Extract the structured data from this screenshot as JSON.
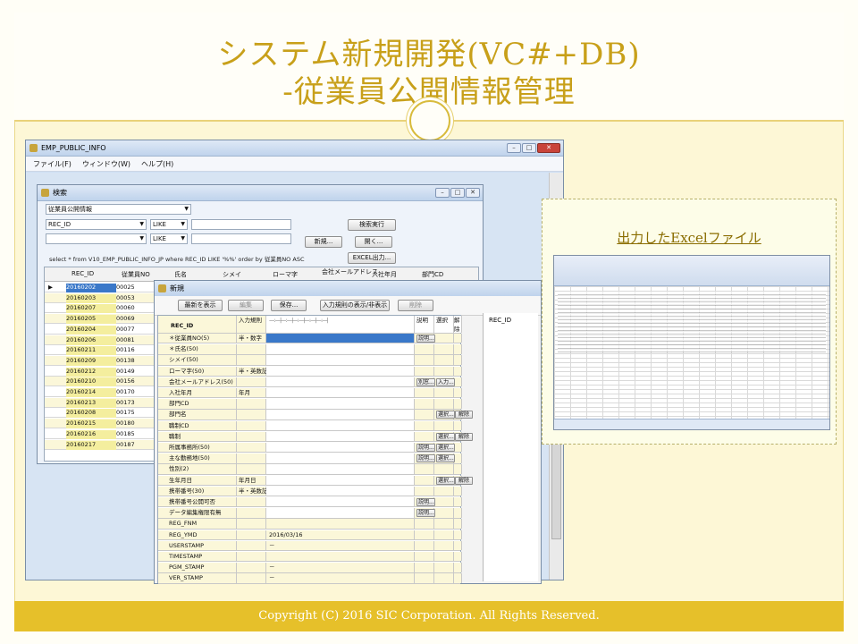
{
  "slide": {
    "title_line1": "システム新規開発(VC#+DB)",
    "title_line2": "-従業員公開情報管理",
    "footer": "Copyright (C) 2016 SIC Corporation. All Rights Reserved.",
    "callout_label": "出力したExcelファイル"
  },
  "main_window": {
    "title": "EMP_PUBLIC_INFO",
    "menu": [
      "ファイル(F)",
      "ウィンドウ(W)",
      "ヘルプ(H)"
    ]
  },
  "search_window": {
    "title": "検索",
    "table_select": "従業員公開情報",
    "cond1_field": "REC_ID",
    "cond1_op": "LIKE",
    "cond2_op": "LIKE",
    "btn_search": "検索実行",
    "btn_new": "新規...",
    "btn_open": "開く...",
    "btn_excel": "EXCEL出力...",
    "sql": "select * from V10_EMP_PUBLIC_INFO_JP  where  REC_ID LIKE '%%'  order by 従業員NO ASC",
    "grid_headers": [
      "REC_ID",
      "従業員NO",
      "氏名",
      "シメイ",
      "ローマ字",
      "会社メールアドレス",
      "入社年月",
      "部門CD"
    ],
    "rows": [
      [
        "20160202",
        "00025"
      ],
      [
        "20160203",
        "00053"
      ],
      [
        "20160207",
        "00060"
      ],
      [
        "20160205",
        "00069"
      ],
      [
        "20160204",
        "00077"
      ],
      [
        "20160206",
        "00081"
      ],
      [
        "20160211",
        "00116"
      ],
      [
        "20160209",
        "00138"
      ],
      [
        "20160212",
        "00149"
      ],
      [
        "20160210",
        "00156"
      ],
      [
        "20160214",
        "00170"
      ],
      [
        "20160213",
        "00173"
      ],
      [
        "20160208",
        "00175"
      ],
      [
        "20160215",
        "00180"
      ],
      [
        "20160216",
        "00185"
      ],
      [
        "20160217",
        "00187"
      ]
    ]
  },
  "new_window": {
    "title": "新規",
    "toolbar": [
      "最新を表示",
      "編集",
      "保存...",
      "入力規則の表示/非表示",
      "削除"
    ],
    "col_headers": {
      "rule": "入力規則",
      "explain": "説明",
      "select": "選択",
      "clear": "解除",
      "first_field": "REC_ID"
    },
    "fields": [
      {
        "label": "＊従業員NO(5)",
        "rule": "半・数字",
        "value": "",
        "buttons": [
          "説明..."
        ]
      },
      {
        "label": "＊氏名(50)",
        "rule": "",
        "value": "",
        "buttons": []
      },
      {
        "label": "シメイ(50)",
        "rule": "",
        "value": "",
        "buttons": []
      },
      {
        "label": "ローマ字(50)",
        "rule": "半・英数記",
        "value": "",
        "buttons": []
      },
      {
        "label": "会社メールアドレス(50)",
        "rule": "",
        "value": "",
        "buttons": [
          "別窓...",
          "入力..."
        ]
      },
      {
        "label": "入社年月",
        "rule": "年月",
        "value": "",
        "buttons": []
      },
      {
        "label": "部門CD",
        "rule": "",
        "value": "",
        "buttons": []
      },
      {
        "label": "部門名",
        "rule": "",
        "value": "",
        "buttons": [
          "選択...",
          "解除"
        ]
      },
      {
        "label": "職制CD",
        "rule": "",
        "value": "",
        "buttons": []
      },
      {
        "label": "職制",
        "rule": "",
        "value": "",
        "buttons": [
          "選択...",
          "解除"
        ]
      },
      {
        "label": "所属事務所(50)",
        "rule": "",
        "value": "",
        "buttons": [
          "説明...",
          "選択..."
        ]
      },
      {
        "label": "主な勤務地(50)",
        "rule": "",
        "value": "",
        "buttons": [
          "説明...",
          "選択..."
        ]
      },
      {
        "label": "性別(2)",
        "rule": "",
        "value": "",
        "buttons": []
      },
      {
        "label": "生年月日",
        "rule": "年月日",
        "value": "",
        "buttons": [
          "選択...",
          "解除"
        ]
      },
      {
        "label": "携帯番号(30)",
        "rule": "半・英数記",
        "value": "",
        "buttons": []
      },
      {
        "label": "携帯番号公開可否",
        "rule": "",
        "value": "",
        "buttons": [
          "説明..."
        ]
      },
      {
        "label": "データ編集権限有無",
        "rule": "",
        "value": "",
        "buttons": [
          "説明..."
        ]
      },
      {
        "label": "REG_FNM",
        "rule": "",
        "value": "",
        "buttons": []
      },
      {
        "label": "REG_YMD",
        "rule": "",
        "value": "2016/03/16",
        "buttons": []
      },
      {
        "label": "USERSTAMP",
        "rule": "",
        "value": "－",
        "buttons": []
      },
      {
        "label": "TIMESTAMP",
        "rule": "",
        "value": "",
        "buttons": []
      },
      {
        "label": "PGM_STAMP",
        "rule": "",
        "value": "－",
        "buttons": []
      },
      {
        "label": "VER_STAMP",
        "rule": "",
        "value": "－",
        "buttons": []
      }
    ],
    "right_label": "REC_ID"
  },
  "colors": {
    "title_gold": "#c8a01a",
    "footer_gold": "#e6c02a",
    "form_yellow": "#fbf7d9"
  }
}
